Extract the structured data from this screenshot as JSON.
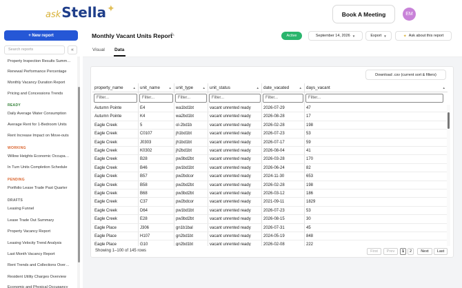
{
  "app": {
    "logo_ask": "ask",
    "logo_stella": "Stella",
    "book_meeting": "Book A Meeting",
    "avatar_initials": "EM"
  },
  "sidebar": {
    "new_report": "+ New report",
    "search_placeholder": "Search reports",
    "collapse_glyph": "«",
    "items": [
      {
        "label": "Property Inspection Results Summary"
      },
      {
        "label": "Renewal Performance Percentage"
      },
      {
        "label": "Monthly Vacancy Duration Report"
      },
      {
        "label": "Pricing and Concessions Trends"
      },
      {
        "section": "READY",
        "color": "#2e7d32"
      },
      {
        "label": "Daily Average Water Consumption"
      },
      {
        "label": "Average Rent for 1-Bedroom Units"
      },
      {
        "label": "Rent Increase Impact on Move-outs"
      },
      {
        "section": "WORKING",
        "color": "#d9622b"
      },
      {
        "label": "Willow Heights Economic Occupancy"
      },
      {
        "label": "In Turn Units Completion Schedule"
      },
      {
        "section": "PENDING",
        "color": "#d9622b"
      },
      {
        "label": "Portfolio Lease Trade Past Quarter"
      },
      {
        "section": "DRAFTS",
        "color": "#666666"
      },
      {
        "label": "Leasing Funnel"
      },
      {
        "label": "Lease Trade Out Summary"
      },
      {
        "label": "Property Vacancy Report"
      },
      {
        "label": "Leasing Velocity Trend Analysis"
      },
      {
        "label": "Last Month Vacancy Report"
      },
      {
        "label": "Rent Trends and Collections Overview"
      },
      {
        "label": "Resident Utility Charges Overview"
      },
      {
        "label": "Economic and Physical Occupancy"
      }
    ]
  },
  "header": {
    "title": "Monthly Vacant Units Report",
    "status": "Active",
    "date": "September 14, 2026",
    "export": "Export",
    "ask": "Ask about this report",
    "accent": "#2557d6",
    "status_color": "#2ab56d"
  },
  "tabs": [
    {
      "label": "Visual",
      "active": false
    },
    {
      "label": "Data",
      "active": true
    }
  ],
  "table": {
    "download": "Download .csv (current sort & filters)",
    "filter_placeholder": "Filter...",
    "columns": [
      "property_name",
      "unit_name",
      "unit_type",
      "unit_status",
      "date_vacated",
      "days_vacant"
    ],
    "rows": [
      [
        "Autumn Pointe",
        "E4",
        "wa1bd1bt",
        "vacant unrented ready",
        "2026-07-29",
        "47"
      ],
      [
        "Autumn Pointe",
        "K4",
        "wa2bd1bt",
        "vacant unrented ready",
        "2026-08-28",
        "17"
      ],
      [
        "Eagle Creek",
        "5",
        "ol-2bd1b",
        "vacant unrented ready",
        "2026-02-28",
        "198"
      ],
      [
        "Eagle Creek",
        "C0107",
        "jh1bd1bt",
        "vacant unrented ready",
        "2026-07-23",
        "53"
      ],
      [
        "Eagle Creek",
        "J0303",
        "jh1bd1bt",
        "vacant unrented ready",
        "2026-07-17",
        "59"
      ],
      [
        "Eagle Creek",
        "K0302",
        "jh2bd1bt",
        "vacant unrented ready",
        "2026-08-04",
        "41"
      ],
      [
        "Eagle Creek",
        "B28",
        "pw3bd2bt",
        "vacant unrented ready",
        "2026-03-28",
        "170"
      ],
      [
        "Eagle Creek",
        "B46",
        "pw1bd1bt",
        "vacant unrented ready",
        "2026-06-24",
        "82"
      ],
      [
        "Eagle Creek",
        "B57",
        "pw2bdcor",
        "vacant unrented ready",
        "2024-11-30",
        "653"
      ],
      [
        "Eagle Creek",
        "B58",
        "pw2bd2bt",
        "vacant unrented ready",
        "2026-02-28",
        "198"
      ],
      [
        "Eagle Creek",
        "B68",
        "pw3bd2bt",
        "vacant unrented ready",
        "2026-03-12",
        "186"
      ],
      [
        "Eagle Creek",
        "C37",
        "pw2bdcor",
        "vacant unrented ready",
        "2021-09-11",
        "1829"
      ],
      [
        "Eagle Creek",
        "D64",
        "pw1bd1bt",
        "vacant unrented ready",
        "2026-07-23",
        "53"
      ],
      [
        "Eagle Creek",
        "E28",
        "pw3bd2bt",
        "vacant unrented ready",
        "2026-08-15",
        "30"
      ],
      [
        "Eagle Place",
        "J306",
        "gn1b1bal",
        "vacant unrented ready",
        "2026-07-31",
        "45"
      ],
      [
        "Eagle Place",
        "H107",
        "gn2bd1bt",
        "vacant unrented ready",
        "2024-05-19",
        "848"
      ],
      [
        "Eagle Place",
        "G10",
        "gn2bd1bt",
        "vacant unrented ready",
        "2026-02-08",
        "222"
      ]
    ],
    "footer": "Showing 1–100 of 145 rows",
    "pager": {
      "first": "First",
      "prev": "Prev",
      "p1": "1",
      "p2": "2",
      "next": "Next",
      "last": "Last"
    }
  }
}
